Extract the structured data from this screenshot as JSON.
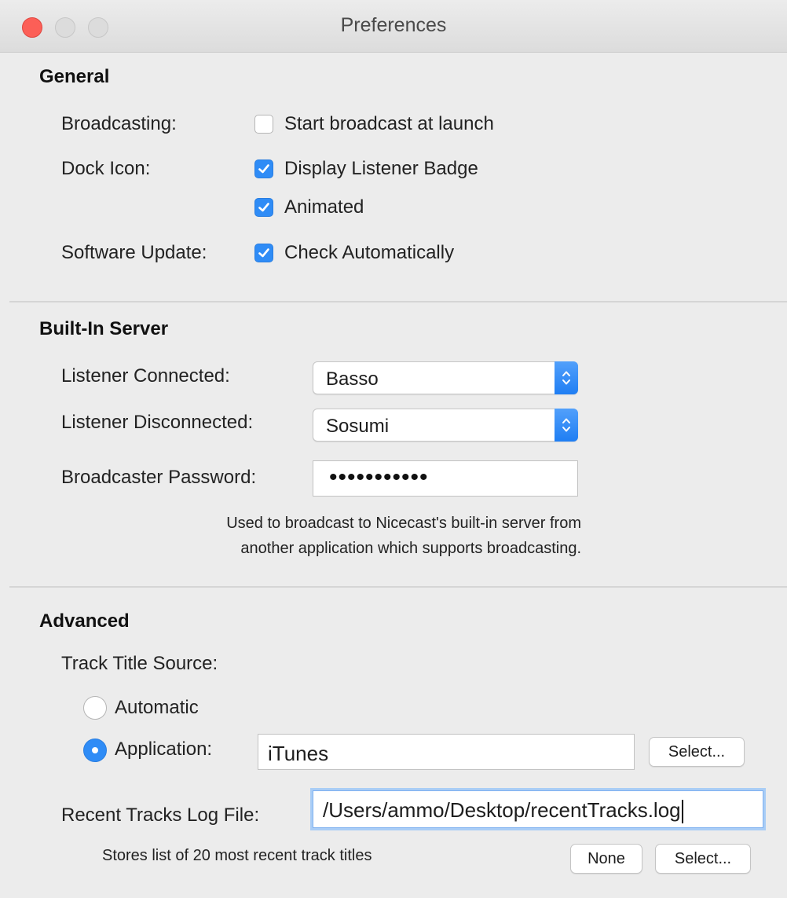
{
  "window": {
    "title": "Preferences",
    "accent_color": "#2f8cf6",
    "close_color": "#fc5f57"
  },
  "general": {
    "heading": "General",
    "broadcasting_label": "Broadcasting:",
    "start_broadcast": {
      "label": "Start broadcast at launch",
      "checked": false
    },
    "dock_icon_label": "Dock Icon:",
    "display_badge": {
      "label": "Display Listener Badge",
      "checked": true
    },
    "animated": {
      "label": "Animated",
      "checked": true
    },
    "software_update_label": "Software Update:",
    "check_automatically": {
      "label": "Check Automatically",
      "checked": true
    }
  },
  "server": {
    "heading": "Built-In Server",
    "connected_label": "Listener Connected:",
    "connected_value": "Basso",
    "disconnected_label": "Listener Disconnected:",
    "disconnected_value": "Sosumi",
    "password_label": "Broadcaster Password:",
    "password_value": "•••••••••••",
    "note_line1": "Used to broadcast to Nicecast's built-in server from",
    "note_line2": "another application which supports broadcasting."
  },
  "advanced": {
    "heading": "Advanced",
    "track_title_label": "Track Title Source:",
    "automatic_label": "Automatic",
    "application_label": "Application:",
    "application_value": "iTunes",
    "select_label": "Select...",
    "selected_source": "Application",
    "log_label": "Recent Tracks Log File:",
    "log_value": "/Users/ammo/Desktop/recentTracks.log",
    "log_note": "Stores list of 20 most recent track titles",
    "none_label": "None",
    "log_select_label": "Select..."
  }
}
